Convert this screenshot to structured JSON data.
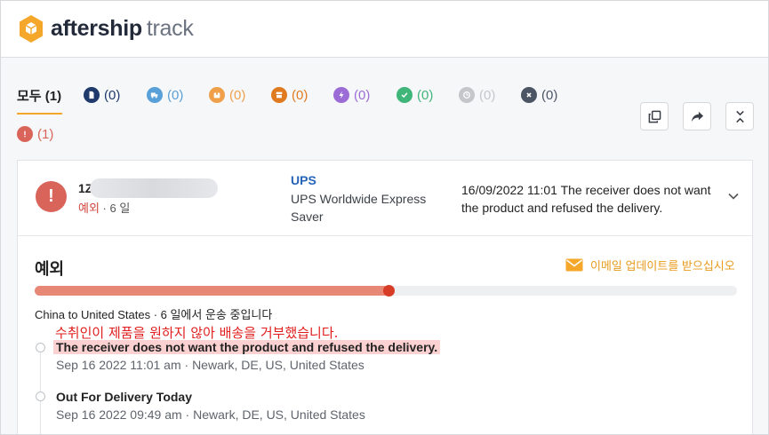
{
  "brand": {
    "name_bold": "aftership",
    "name_light": "track",
    "accent": "#f4a72a"
  },
  "tabs": [
    {
      "name": "all",
      "label": "모두 (1)",
      "color": "#222222"
    },
    {
      "name": "info-received",
      "label": "(0)",
      "color": "#1f3a6b",
      "icon": "document-icon"
    },
    {
      "name": "in-transit",
      "label": "(0)",
      "color": "#5aa0d8",
      "icon": "truck-icon"
    },
    {
      "name": "out-for-delivery",
      "label": "(0)",
      "color": "#f0a04b",
      "icon": "package-icon"
    },
    {
      "name": "available-for-pickup",
      "label": "(0)",
      "color": "#e07a1f",
      "icon": "store-icon"
    },
    {
      "name": "failed-attempt",
      "label": "(0)",
      "color": "#9b6cd6",
      "icon": "lightning-icon"
    },
    {
      "name": "delivered",
      "label": "(0)",
      "color": "#3fb57a",
      "icon": "check-icon"
    },
    {
      "name": "expired",
      "label": "(0)",
      "color": "#c4c6ca",
      "icon": "clock-icon"
    },
    {
      "name": "pending",
      "label": "(0)",
      "color": "#4b5563",
      "icon": "x-icon"
    },
    {
      "name": "exception",
      "label": "(1)",
      "color": "#d9645a",
      "icon": "exclamation-icon"
    }
  ],
  "toolbar": {
    "copy_icon": "copy-icon",
    "share_icon": "share-icon",
    "collapse_icon": "collapse-icon"
  },
  "shipment": {
    "tracking_prefix": "1Z",
    "status_label": "예외",
    "days_label": " · 6 일",
    "carrier": "UPS",
    "service": "UPS Worldwide Express Saver",
    "latest_event": "16/09/2022 11:01 The receiver does not want the product and refused the delivery."
  },
  "detail": {
    "title": "예외",
    "email_link": "이메일 업데이트를 받으십시오",
    "progress_fraction": 0.505,
    "route": "China to United States · 6 일에서 운송 중입니다",
    "annotation": "수취인이 제품을 원하지 않아 배송을 거부했습니다.",
    "events": [
      {
        "title": "The receiver does not want the product and refused the delivery.",
        "meta": "Sep 16 2022 11:01 am · Newark, DE, US, United States"
      },
      {
        "title": "Out For Delivery Today",
        "meta": "Sep 16 2022 09:49 am · Newark, DE, US, United States"
      }
    ]
  }
}
